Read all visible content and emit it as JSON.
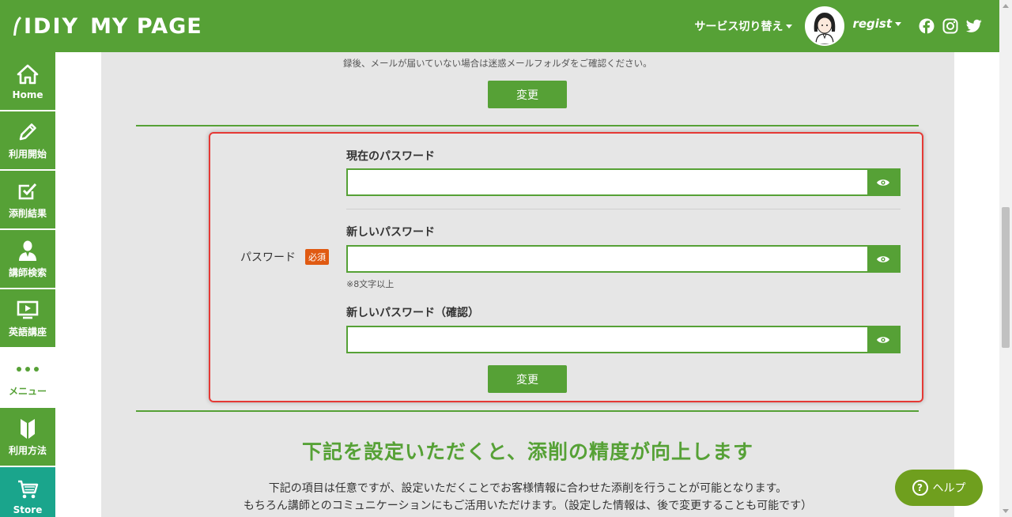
{
  "header": {
    "logo_brand": "IDIY",
    "logo_page": "MY PAGE",
    "service_switch": "サービス切り替え",
    "username": "regist",
    "social": [
      "facebook-icon",
      "instagram-icon",
      "twitter-icon"
    ]
  },
  "sidebar": {
    "items": [
      {
        "label": "Home",
        "icon": "home-icon"
      },
      {
        "label": "利用開始",
        "icon": "pencil-icon"
      },
      {
        "label": "添削結果",
        "icon": "checkbox-icon"
      },
      {
        "label": "講師検索",
        "icon": "teacher-icon"
      },
      {
        "label": "英語講座",
        "icon": "video-icon"
      },
      {
        "label": "メニュー",
        "icon": "more-dots-icon"
      },
      {
        "label": "利用方法",
        "icon": "beginner-mark-icon"
      },
      {
        "label": "Store",
        "icon": "cart-icon"
      }
    ]
  },
  "email_section": {
    "note": "録後、メールが届いていない場合は迷惑メールフォルダをご確認ください。",
    "change_label": "変更"
  },
  "password_section": {
    "label": "パスワード",
    "required_badge": "必須",
    "current_label": "現在のパスワード",
    "new_label": "新しいパスワード",
    "hint": "※8文字以上",
    "confirm_label": "新しいパスワード（確認）",
    "change_label": "変更"
  },
  "info_section": {
    "headline": "下記を設定いただくと、添削の精度が向上します",
    "line1": "下記の項目は任意ですが、設定いただくことでお客様情報に合わせた添削を行うことが可能となります。",
    "line2": "もちろん講師とのコミュニケーションにもご活用いただけます。（設定した情報は、後で変更することも可能です）"
  },
  "help": {
    "label": "ヘルプ"
  },
  "colors": {
    "brand_green": "#56a136",
    "store_teal": "#1aa58c",
    "required_orange": "#e05a12",
    "highlight_red": "#e53935"
  }
}
